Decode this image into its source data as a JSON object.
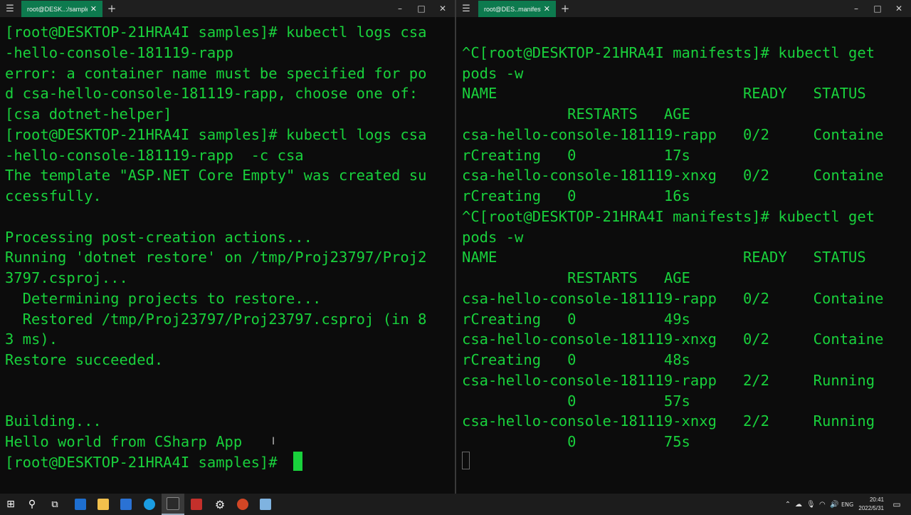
{
  "left_window": {
    "tab_title": "root@DESK..:/samples",
    "tab_close": "✕",
    "menu_icon": "☰",
    "new_tab": "+",
    "controls": {
      "minimize": "–",
      "maximize": "□",
      "close": "✕"
    },
    "lines": [
      "[root@DESKTOP-21HRA4I samples]# kubectl logs csa",
      "-hello-console-181119-rapp",
      "error: a container name must be specified for po",
      "d csa-hello-console-181119-rapp, choose one of:",
      "[csa dotnet-helper]",
      "[root@DESKTOP-21HRA4I samples]# kubectl logs csa",
      "-hello-console-181119-rapp  -c csa",
      "The template \"ASP.NET Core Empty\" was created su",
      "ccessfully.",
      "",
      "Processing post-creation actions...",
      "Running 'dotnet restore' on /tmp/Proj23797/Proj2",
      "3797.csproj...",
      "  Determining projects to restore...",
      "  Restored /tmp/Proj23797/Proj23797.csproj (in 8",
      "3 ms).",
      "Restore succeeded.",
      "",
      "",
      "Building...",
      "Hello world from CSharp App",
      "[root@DESKTOP-21HRA4I samples]# "
    ]
  },
  "right_window": {
    "tab_title": "root@DES..manifests",
    "tab_close": "✕",
    "menu_icon": "☰",
    "new_tab": "+",
    "controls": {
      "minimize": "–",
      "maximize": "□",
      "close": "✕"
    },
    "lines": [
      "",
      "^C[root@DESKTOP-21HRA4I manifests]# kubectl get",
      "pods -w",
      "NAME                            READY   STATUS",
      "            RESTARTS   AGE",
      "csa-hello-console-181119-rapp   0/2     Containe",
      "rCreating   0          17s",
      "csa-hello-console-181119-xnxg   0/2     Containe",
      "rCreating   0          16s",
      "^C[root@DESKTOP-21HRA4I manifests]# kubectl get",
      "pods -w",
      "NAME                            READY   STATUS",
      "            RESTARTS   AGE",
      "csa-hello-console-181119-rapp   0/2     Containe",
      "rCreating   0          49s",
      "csa-hello-console-181119-xnxg   0/2     Containe",
      "rCreating   0          48s",
      "csa-hello-console-181119-rapp   2/2     Running",
      "            0          57s",
      "csa-hello-console-181119-xnxg   2/2     Running",
      "            0          75s"
    ]
  },
  "mouse_cursor": "I",
  "taskbar": {
    "start_icon": "⊞",
    "search_icon": "⚲",
    "taskview_icon": "⧉",
    "settings_icon": "⚙",
    "tray_chevron": "⌃",
    "language": "ENG",
    "time": "20:41",
    "date": "2022/5/31",
    "notification_icon": "▭",
    "colors": {
      "mail": "#1e6fd0",
      "explorer": "#f2c04c",
      "app": "#2a72d4",
      "edge": "#1b9de2",
      "terminal": "#2b2b2b",
      "red_app": "#c4302b",
      "powerpoint": "#d24625",
      "notepad": "#7fb3e0"
    }
  },
  "colors": {
    "terminal_text": "#19d13c",
    "terminal_bg": "#0c0c0c",
    "tab_active": "#0d7a4e"
  }
}
